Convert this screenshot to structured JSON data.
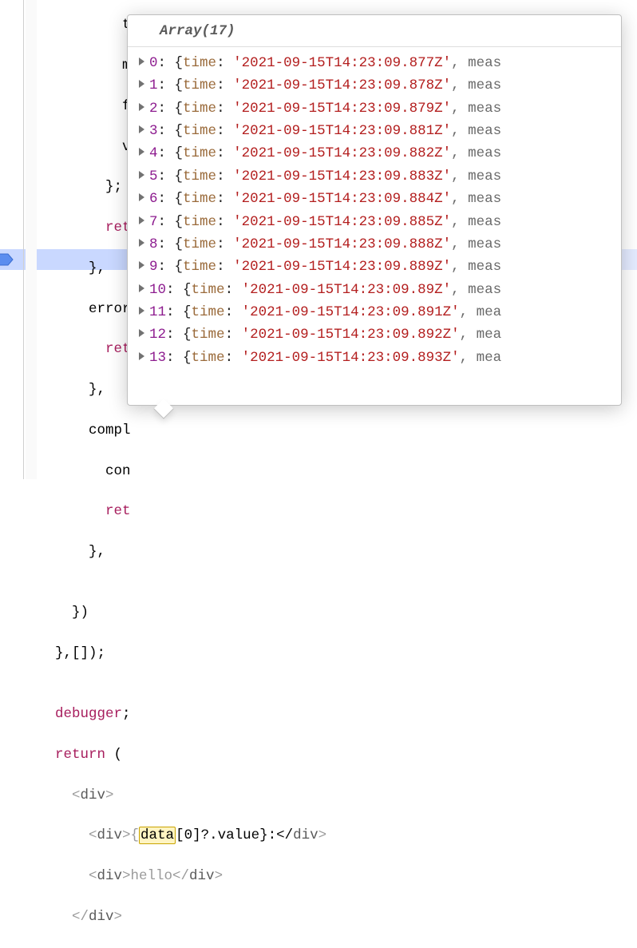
{
  "code": {
    "l0": "          time: o._time,",
    "l1": "          m",
    "l2": "          f",
    "l3": "          v",
    "l4": "        };",
    "l5_a": "        ",
    "l5_ret": "ret",
    "l6": "      },",
    "l7": "      error",
    "l8_a": "        ",
    "l8_ret": "ret",
    "l9": "      },",
    "l10": "      compl",
    "l11": "        con",
    "l12_a": "        ",
    "l12_ret": "ret",
    "l13": "      },",
    "l14": "",
    "l15": "    })",
    "l16": "  },[]);",
    "l17": "",
    "l18_a": "  ",
    "l18_deb": "debugger",
    "l18_b": ";",
    "l19_a": "  ",
    "l19_ret": "return",
    "l19_b": " (",
    "l20_a": "    <",
    "l20_tag": "div",
    "l20_b": ">",
    "l21_a": "      <",
    "l21_tag": "div",
    "l21_b": ">{",
    "l21_data": "data",
    "l21_c": "[0]?.value}:</",
    "l21_tag2": "div",
    "l21_d": ">",
    "l22_a": "      <",
    "l22_tag": "div",
    "l22_b": ">hello</",
    "l22_tag2": "div",
    "l22_c": ">",
    "l23_a": "    </",
    "l23_tag": "div",
    "l23_b": ">"
  },
  "tooltip": {
    "header": "Array(17)",
    "rows": [
      {
        "index": "0",
        "key": "time",
        "value": "'2021-09-15T14:23:09.877Z'",
        "more": "meas"
      },
      {
        "index": "1",
        "key": "time",
        "value": "'2021-09-15T14:23:09.878Z'",
        "more": "meas"
      },
      {
        "index": "2",
        "key": "time",
        "value": "'2021-09-15T14:23:09.879Z'",
        "more": "meas"
      },
      {
        "index": "3",
        "key": "time",
        "value": "'2021-09-15T14:23:09.881Z'",
        "more": "meas"
      },
      {
        "index": "4",
        "key": "time",
        "value": "'2021-09-15T14:23:09.882Z'",
        "more": "meas"
      },
      {
        "index": "5",
        "key": "time",
        "value": "'2021-09-15T14:23:09.883Z'",
        "more": "meas"
      },
      {
        "index": "6",
        "key": "time",
        "value": "'2021-09-15T14:23:09.884Z'",
        "more": "meas"
      },
      {
        "index": "7",
        "key": "time",
        "value": "'2021-09-15T14:23:09.885Z'",
        "more": "meas"
      },
      {
        "index": "8",
        "key": "time",
        "value": "'2021-09-15T14:23:09.888Z'",
        "more": "meas"
      },
      {
        "index": "9",
        "key": "time",
        "value": "'2021-09-15T14:23:09.889Z'",
        "more": "meas"
      },
      {
        "index": "10",
        "key": "time",
        "value": "'2021-09-15T14:23:09.89Z'",
        "more": "meas"
      },
      {
        "index": "11",
        "key": "time",
        "value": "'2021-09-15T14:23:09.891Z'",
        "more": "mea"
      },
      {
        "index": "12",
        "key": "time",
        "value": "'2021-09-15T14:23:09.892Z'",
        "more": "mea"
      },
      {
        "index": "13",
        "key": "time",
        "value": "'2021-09-15T14:23:09.893Z'",
        "more": "mea"
      }
    ]
  }
}
